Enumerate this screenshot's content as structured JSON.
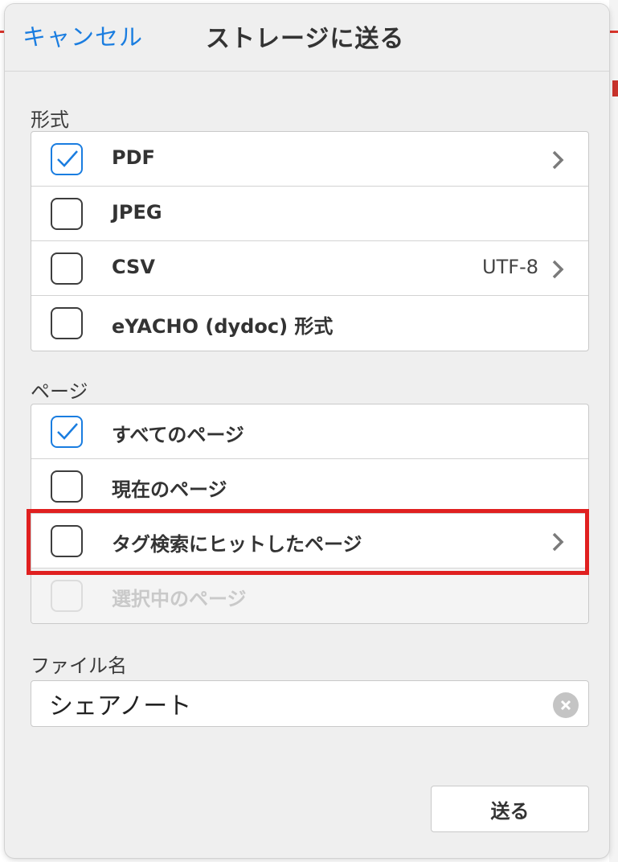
{
  "header": {
    "cancel_label": "キャンセル",
    "title": "ストレージに送る"
  },
  "format_section": {
    "label": "形式",
    "items": [
      {
        "label": "PDF",
        "checked": true,
        "value": "",
        "has_chevron": true
      },
      {
        "label": "JPEG",
        "checked": false,
        "value": "",
        "has_chevron": false
      },
      {
        "label": "CSV",
        "checked": false,
        "value": "UTF-8",
        "has_chevron": true
      },
      {
        "label": "eYACHO (dydoc) 形式",
        "checked": false,
        "value": "",
        "has_chevron": false
      }
    ]
  },
  "page_section": {
    "label": "ページ",
    "items": [
      {
        "label": "すべてのページ",
        "checked": true,
        "disabled": false,
        "has_chevron": false
      },
      {
        "label": "現在のページ",
        "checked": false,
        "disabled": false,
        "has_chevron": false
      },
      {
        "label": "タグ検索にヒットしたページ",
        "checked": false,
        "disabled": false,
        "has_chevron": true
      },
      {
        "label": "選択中のページ",
        "checked": false,
        "disabled": true,
        "has_chevron": false
      }
    ]
  },
  "filename_section": {
    "label": "ファイル名",
    "value": "シェアノート"
  },
  "send_label": "送る",
  "colors": {
    "accent": "#1a7de0",
    "highlight": "#e02020"
  }
}
